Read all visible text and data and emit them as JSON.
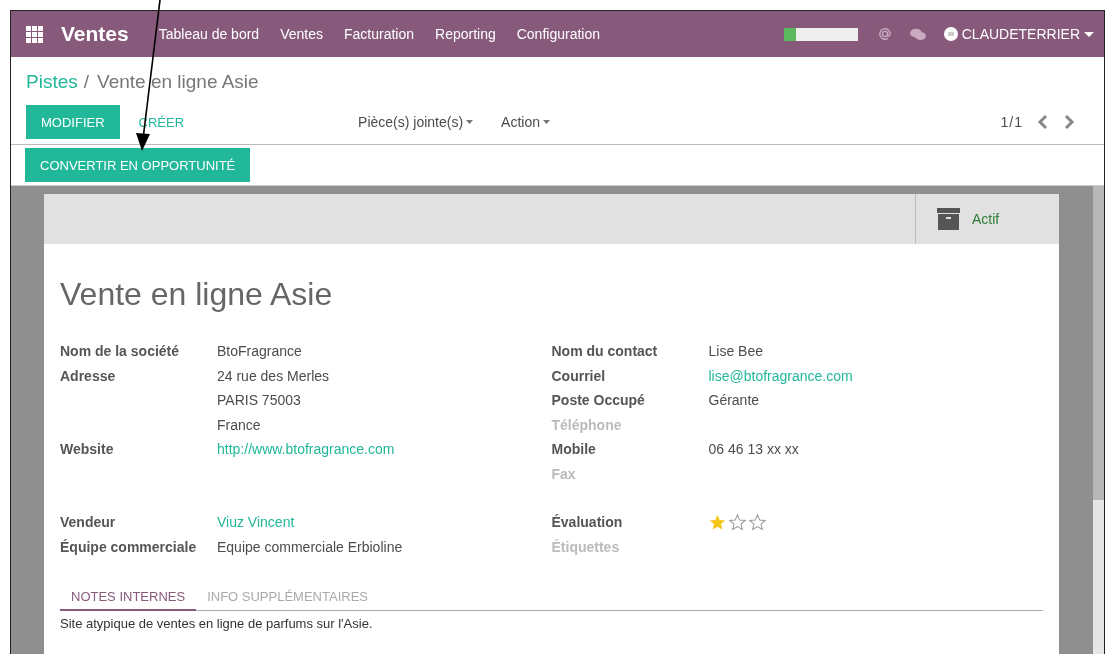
{
  "navbar": {
    "app_title": "Ventes",
    "menu": [
      "Tableau de bord",
      "Ventes",
      "Facturation",
      "Reporting",
      "Configuration"
    ],
    "progress": {
      "level": 0.16
    },
    "user": "CLAUDETERRIER"
  },
  "breadcrumb_separator": "/",
  "breadcrumb": [
    {
      "label": "Pistes",
      "link": true
    },
    {
      "label": "Vente en ligne Asie",
      "link": false
    }
  ],
  "actions": {
    "primary": "MODIFIER",
    "secondary": "CRÉER",
    "dropdowns": [
      "Pièce(s) jointe(s)",
      "Action"
    ],
    "pager": "1/1"
  },
  "statusbar": {
    "button": "CONVERTIR EN OPPORTUNITÉ"
  },
  "sheet": {
    "status_button": "Actif",
    "title": "Vente en ligne Asie",
    "groups": [
      {
        "left": [
          {
            "label": "Nom de la société",
            "muted": false,
            "kind": "text",
            "values": [
              "BtoFragrance"
            ]
          },
          {
            "label": "Adresse",
            "muted": false,
            "kind": "text",
            "values": [
              "24 rue des Merles",
              "PARIS  75003",
              "France"
            ]
          },
          {
            "label": "Website",
            "muted": false,
            "kind": "link",
            "values": [
              "http://www.btofragrance.com"
            ]
          }
        ],
        "right": [
          {
            "label": "Nom du contact",
            "muted": false,
            "kind": "text",
            "values": [
              "Lise Bee"
            ]
          },
          {
            "label": "Courriel",
            "muted": false,
            "kind": "link",
            "values": [
              "lise@btofragrance.com"
            ]
          },
          {
            "label": "Poste Occupé",
            "muted": false,
            "kind": "text",
            "values": [
              "Gérante"
            ]
          },
          {
            "label": "Téléphone",
            "muted": true,
            "kind": "text"
          },
          {
            "label": "Mobile",
            "muted": false,
            "kind": "text",
            "values": [
              "06 46 13 xx xx"
            ]
          },
          {
            "label": "Fax",
            "muted": true,
            "kind": "text"
          }
        ]
      },
      {
        "left": [
          {
            "label": "Vendeur",
            "muted": false,
            "kind": "link",
            "values": [
              "Viuz Vincent"
            ]
          },
          {
            "label": "Équipe commerciale",
            "muted": false,
            "kind": "text",
            "values": [
              "Equipe commerciale Erbioline"
            ]
          }
        ],
        "right": [
          {
            "label": "Évaluation",
            "muted": false,
            "kind": "stars",
            "stars": 1
          },
          {
            "label": "Étiquettes",
            "muted": true,
            "kind": "text"
          }
        ]
      }
    ],
    "tabs": [
      {
        "label": "NOTES INTERNES",
        "selected": true
      },
      {
        "label": "INFO SUPPLÉMENTAIRES",
        "selected": false
      }
    ],
    "note": "Site atypique de ventes en ligne de parfums sur l'Asie."
  }
}
